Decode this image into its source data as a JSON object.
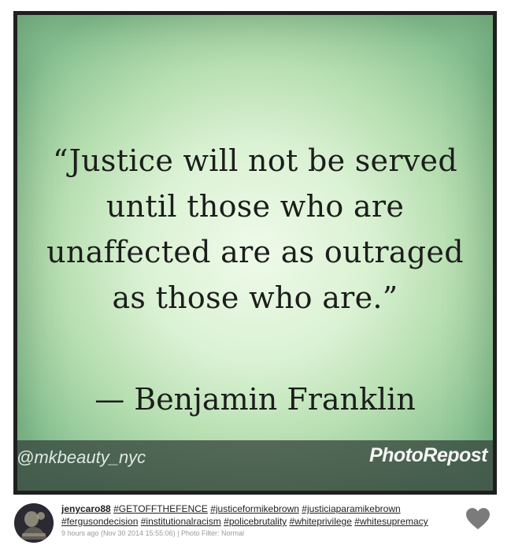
{
  "photo": {
    "quote_lines": [
      "“Justice will not be served",
      "until those who are",
      "unaffected are as outraged",
      "as those who are.”"
    ],
    "author": "— Benjamin Franklin",
    "handle": "@mkbeauty_nyc",
    "watermark": "PhotoRepost"
  },
  "post": {
    "username": "jenycaro88",
    "hashtags": [
      "#GETOFFTHEFENCE",
      "#justiceformikebrown",
      "#justiciaparamikebrown",
      "#fergusondecision",
      "#institutionalracism",
      "#policebrutality",
      "#whiteprivilege",
      "#whitesupremacy"
    ],
    "timestamp": "9 hours ago (Nov 30 2014 15:55:06) | Photo Filter: Normal"
  },
  "icons": {
    "like": "heart-icon",
    "avatar": "user-avatar"
  },
  "colors": {
    "heart": "#7b7b7b",
    "bar": "#37463e",
    "quote_text": "#1c1d1c"
  }
}
